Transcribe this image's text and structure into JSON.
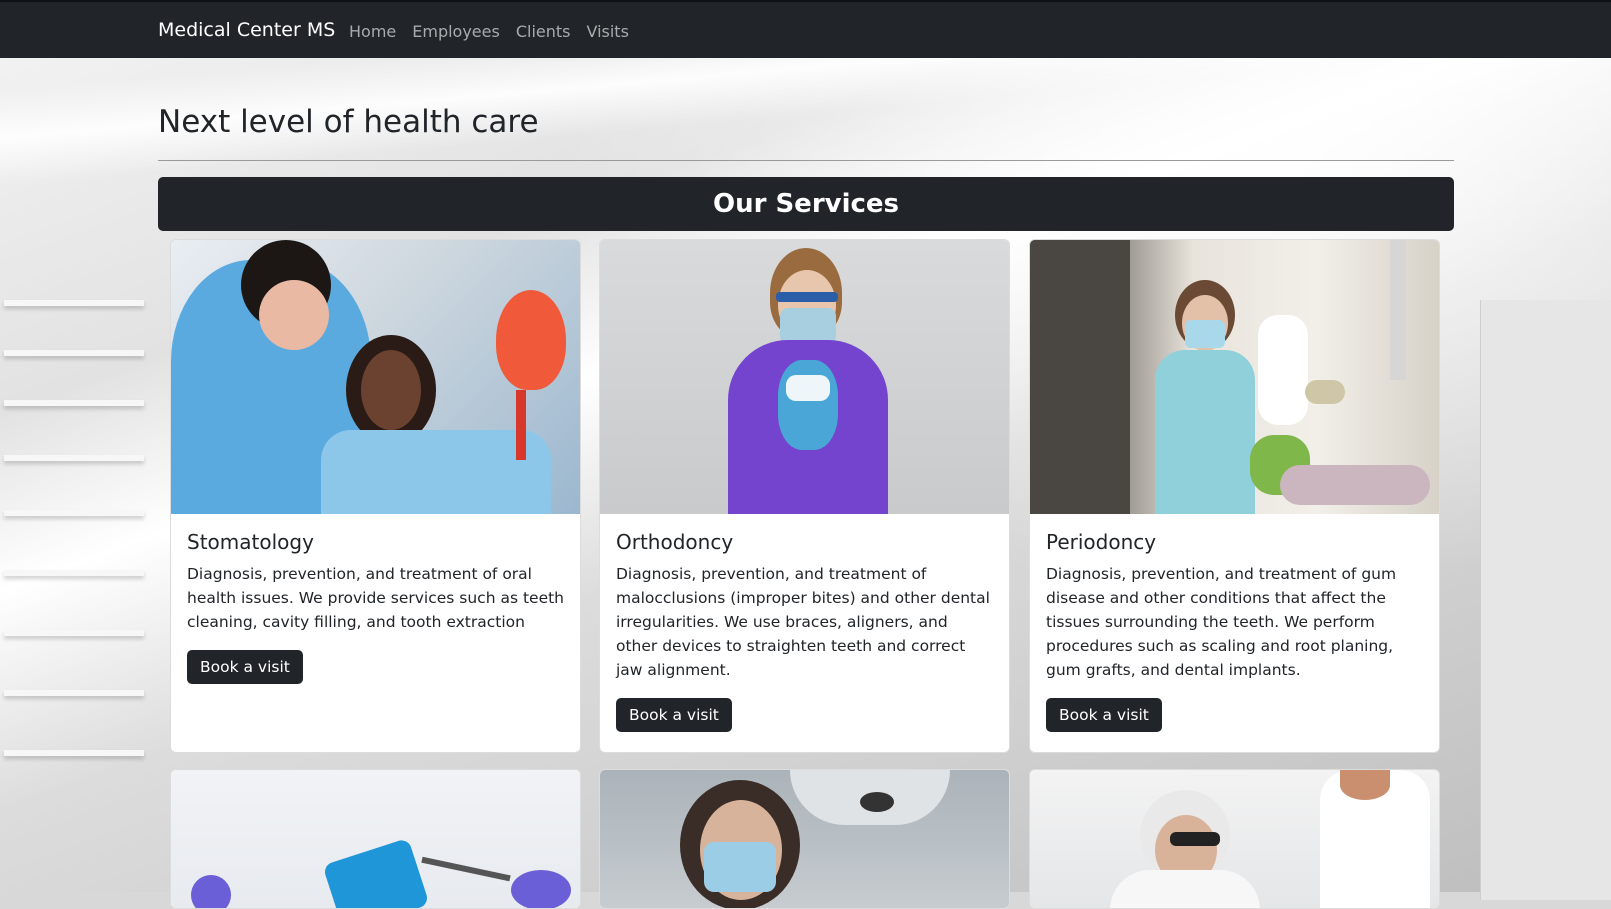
{
  "navbar": {
    "brand": "Medical Center MS",
    "links": [
      "Home",
      "Employees",
      "Clients",
      "Visits"
    ]
  },
  "page": {
    "heading": "Next level of health care",
    "services_title": "Our Services"
  },
  "services": [
    {
      "title": "Stomatology",
      "text": "Diagnosis, prevention, and treatment of oral health issues. We provide services such as teeth cleaning, cavity filling, and tooth extraction",
      "button": "Book a visit"
    },
    {
      "title": "Orthodoncy",
      "text": "Diagnosis, prevention, and treatment of malocclusions (improper bites) and other dental irregularities. We use braces, aligners, and other devices to straighten teeth and correct jaw alignment.",
      "button": "Book a visit"
    },
    {
      "title": "Periodoncy",
      "text": "Diagnosis, prevention, and treatment of gum disease and other conditions that affect the tissues surrounding the teeth. We perform procedures such as scaling and root planing, gum grafts, and dental implants.",
      "button": "Book a visit"
    }
  ],
  "colors": {
    "navbar": "#212529",
    "nav_link": "#a8abad",
    "button": "#212529"
  }
}
